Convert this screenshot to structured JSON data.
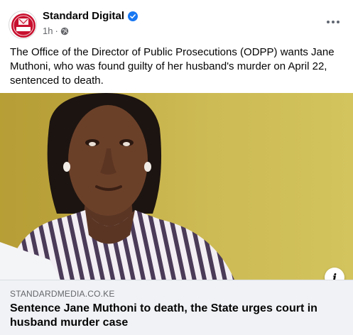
{
  "post": {
    "page_name": "Standard Digital",
    "timestamp": "1h",
    "separator": "·",
    "avatar_text": "Standard",
    "caption": "The Office of the Director of Public Prosecutions (ODPP) wants Jane Muthoni, who was found guilty of her husband's murder on April 22, sentenced to death."
  },
  "link_preview": {
    "domain": "STANDARDMEDIA.CO.KE",
    "title": "Sentence Jane Muthoni to death, the State urges court in husband murder case"
  },
  "icons": {
    "verified": "verified-badge-icon",
    "audience": "globe-icon",
    "more": "more-options-icon",
    "info": "info-icon"
  },
  "colors": {
    "verified_blue": "#1877f2",
    "brand_red": "#c8102e",
    "secondary_text": "#65676b",
    "link_box_bg": "#f0f2f5"
  }
}
